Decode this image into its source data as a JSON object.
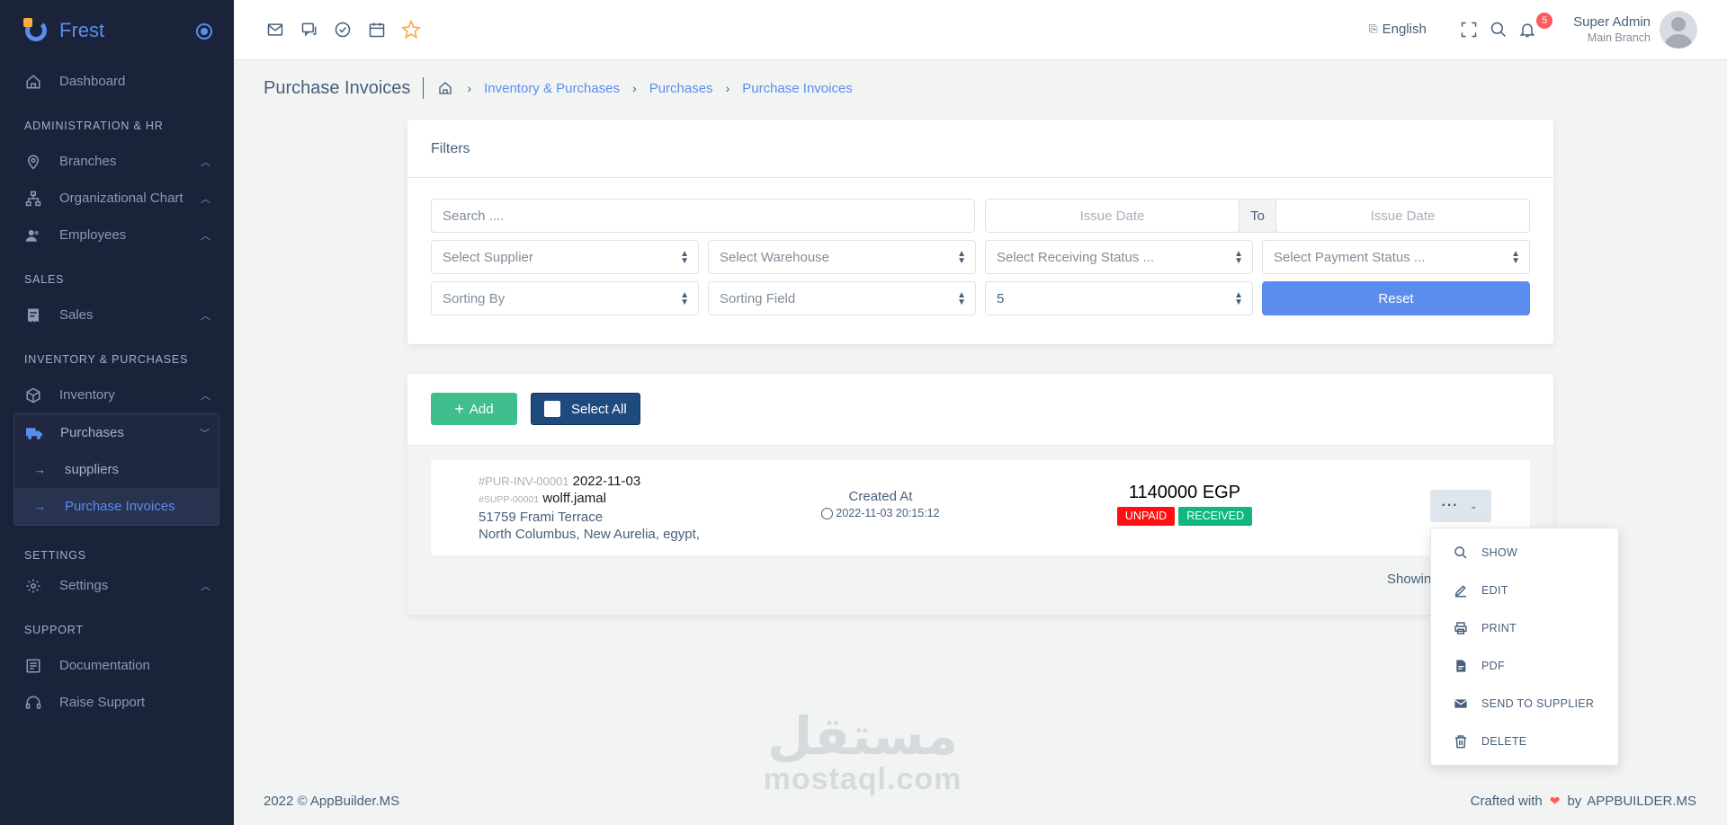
{
  "brand": {
    "name": "Frest"
  },
  "sidebar": {
    "dashboard": "Dashboard",
    "sections": {
      "admin": "ADMINISTRATION & HR",
      "sales": "SALES",
      "inventory": "INVENTORY & PURCHASES",
      "settings": "SETTINGS",
      "support": "SUPPORT"
    },
    "branches": "Branches",
    "org_chart": "Organizational Chart",
    "employees": "Employees",
    "sales": "Sales",
    "inventory": "Inventory",
    "purchases": "Purchases",
    "suppliers": "suppliers",
    "purchase_invoices": "Purchase Invoices",
    "settings": "Settings",
    "documentation": "Documentation",
    "raise_support": "Raise Support"
  },
  "topbar": {
    "language": "English",
    "notifications_count": "5",
    "user_name": "Super Admin",
    "user_branch": "Main Branch"
  },
  "breadcrumb": {
    "page_title": "Purchase Invoices",
    "items": [
      "Inventory & Purchases",
      "Purchases",
      "Purchase Invoices"
    ]
  },
  "filters": {
    "title": "Filters",
    "search_placeholder": "Search ....",
    "issue_date_from": "Issue Date",
    "to_label": "To",
    "issue_date_to": "Issue Date",
    "supplier": "Select Supplier",
    "warehouse": "Select Warehouse",
    "receiving_status": "Select Receiving Status ...",
    "payment_status": "Select Payment Status ...",
    "sorting_by": "Sorting By",
    "sorting_field": "Sorting Field",
    "per_page": "5",
    "reset": "Reset"
  },
  "list": {
    "add": "Add",
    "select_all": "Select All",
    "showing": "Showin"
  },
  "invoice": {
    "number": "#PUR-INV-00001",
    "date": "2022-11-03",
    "supplier_code": "#SUPP-00001",
    "supplier_name": "wolff.jamal",
    "address_line1": "51759 Frami Terrace",
    "address_line2": "North Columbus, New Aurelia, egypt,",
    "created_label": "Created At",
    "created_at": "2022-11-03 20:15:12",
    "amount": "1140000 EGP",
    "payment_status": "UNPAID",
    "receiving_status": "RECEIVED",
    "actions": "···"
  },
  "menu": {
    "show": "SHOW",
    "edit": "EDIT",
    "print": "PRINT",
    "pdf": "PDF",
    "send": "SEND TO SUPPLIER",
    "delete": "DELETE"
  },
  "watermark": {
    "arabic": "مستقل",
    "latin": "mostaql.com"
  },
  "footer": {
    "copyright": "2022 © AppBuilder.MS",
    "crafted": "Crafted with",
    "by": "by",
    "company": "APPBUILDER.MS"
  },
  "colors": {
    "primary": "#5a8dee",
    "sidebar": "#1a233a",
    "success": "#10b77f",
    "danger": "#ff0f0f",
    "navy": "#1e4a7e"
  }
}
